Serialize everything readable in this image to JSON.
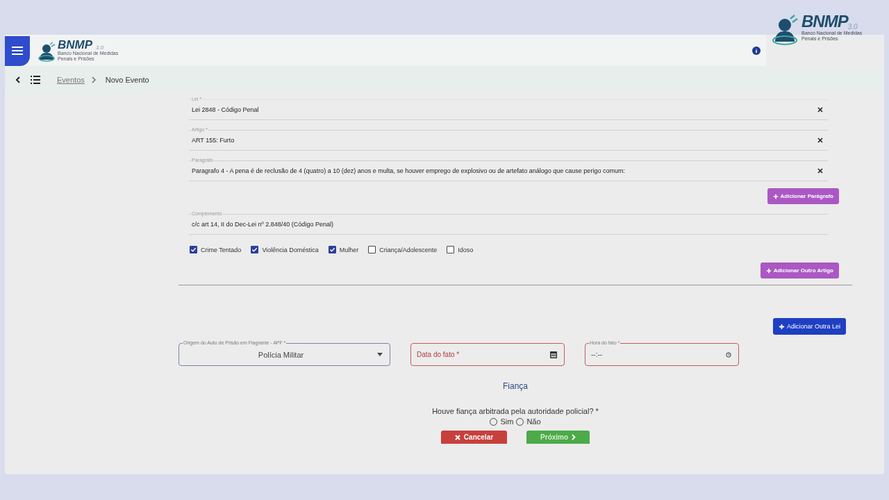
{
  "header": {
    "logo": {
      "name": "BNMP",
      "version": "3.0",
      "subtitle": "Banco Nacional de Medidas Penais e Prisões"
    }
  },
  "brand": {
    "name": "BNMP",
    "version": "3.0",
    "subtitle_lines": [
      "Banco Nacional de Medidas",
      "Penais e Prisões"
    ]
  },
  "breadcrumb": [
    {
      "label": "Eventos",
      "link": true
    },
    {
      "label": "Novo Evento",
      "link": false
    }
  ],
  "law": {
    "fields": [
      {
        "label": "Lei *",
        "value": "Lei 2848 - Código Penal",
        "clearable": true
      },
      {
        "label": "Artigo *",
        "value": "ART 155: Furto",
        "clearable": true
      },
      {
        "label": "Paragrafo",
        "value": "Paragrafo 4 - A pena é de reclusão de 4 (quatro) a 10 (dez) anos e multa, se houver emprego de explosivo ou de artefato análogo que cause perigo comum:",
        "clearable": true
      }
    ],
    "add_paragraph_button": "Adicionar Parágrafo",
    "complement": {
      "label": "Complemento",
      "value": "c/c art 14, II do Dec-Lei nº 2.848/40 (Código Penal)"
    },
    "checkboxes": [
      {
        "label": "Crime Tentado",
        "checked": true
      },
      {
        "label": "Violência Doméstica",
        "checked": true
      },
      {
        "label": "Mulher",
        "checked": true
      },
      {
        "label": "Criança/Adolescente",
        "checked": false
      },
      {
        "label": "Idoso",
        "checked": false
      }
    ],
    "add_article_button": "Adicionar Outro Artigo"
  },
  "add_law_button": "Adicionar Outra Lei",
  "event_fields": [
    {
      "kind": "select",
      "label": "Origem do Auto de Prisão em Flagrante - APF *",
      "value": "Polícia Militar",
      "invalid": false
    },
    {
      "kind": "date",
      "placeholder": "Data do fato *",
      "invalid": true
    },
    {
      "kind": "time",
      "label": "Hora do fato *",
      "value": "--:--",
      "invalid": true
    }
  ],
  "fianca": {
    "title": "Fiança",
    "question": "Houve fiança arbitrada pela autoridade policial? *",
    "options": [
      {
        "label": "Sim",
        "selected": false
      },
      {
        "label": "Não",
        "selected": false
      }
    ]
  },
  "buttons": [
    {
      "kind": "cancel",
      "label": "Cancelar"
    },
    {
      "kind": "next",
      "label": "Próximo"
    }
  ]
}
